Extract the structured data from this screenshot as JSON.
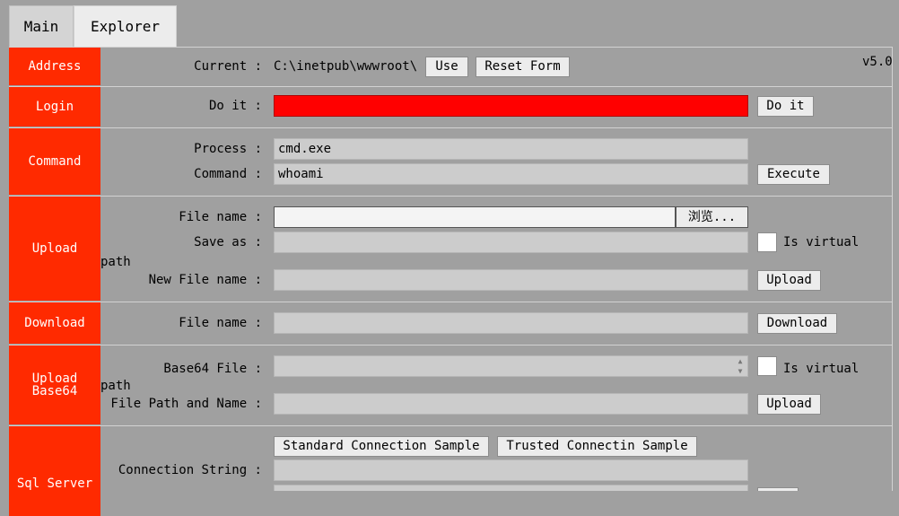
{
  "tabs": [
    {
      "label": "Main"
    },
    {
      "label": "Explorer"
    }
  ],
  "version": "v5.0",
  "sections": {
    "address": {
      "side": "Address"
    },
    "login": {
      "side": "Login"
    },
    "command": {
      "side": "Command"
    },
    "upload": {
      "side": "Upload"
    },
    "download": {
      "side": "Download"
    },
    "upload_base64": {
      "side_line1": "Upload",
      "side_line2": "Base64"
    },
    "sql": {
      "side": "Sql Server"
    }
  },
  "address": {
    "current_label": "Current :",
    "current_path": "C:\\inetpub\\wwwroot\\",
    "use_button": "Use",
    "reset_button": "Reset Form"
  },
  "login": {
    "doit_label": "Do it :",
    "password_value": "",
    "doit_button": "Do it",
    "field_color": "#ff0000"
  },
  "command": {
    "process_label": "Process :",
    "process_value": "cmd.exe",
    "command_label": "Command :",
    "command_value": "whoami",
    "execute_button": "Execute"
  },
  "upload": {
    "file_label": "File name :",
    "browse_button": "浏览...",
    "saveas_label": "Save as :",
    "saveas_value": "",
    "is_virtual": "Is virtual",
    "path_word": "path",
    "newfile_label": "New File name :",
    "newfile_value": "",
    "upload_button": "Upload"
  },
  "download": {
    "file_label": "File name :",
    "file_value": "",
    "download_button": "Download"
  },
  "upload_base64": {
    "b64_label": "Base64 File :",
    "b64_value": "",
    "is_virtual": "Is virtual",
    "path_word": "path",
    "filepath_label": "File Path and Name :",
    "filepath_value": "",
    "upload_button": "Upload"
  },
  "sql": {
    "standard_button": "Standard Connection Sample",
    "trusted_button": "Trusted Connectin Sample",
    "conn_label": "Connection String :",
    "conn_value": ""
  },
  "icons": {
    "spin_up": "spin-up-icon",
    "spin_down": "spin-down-icon"
  }
}
